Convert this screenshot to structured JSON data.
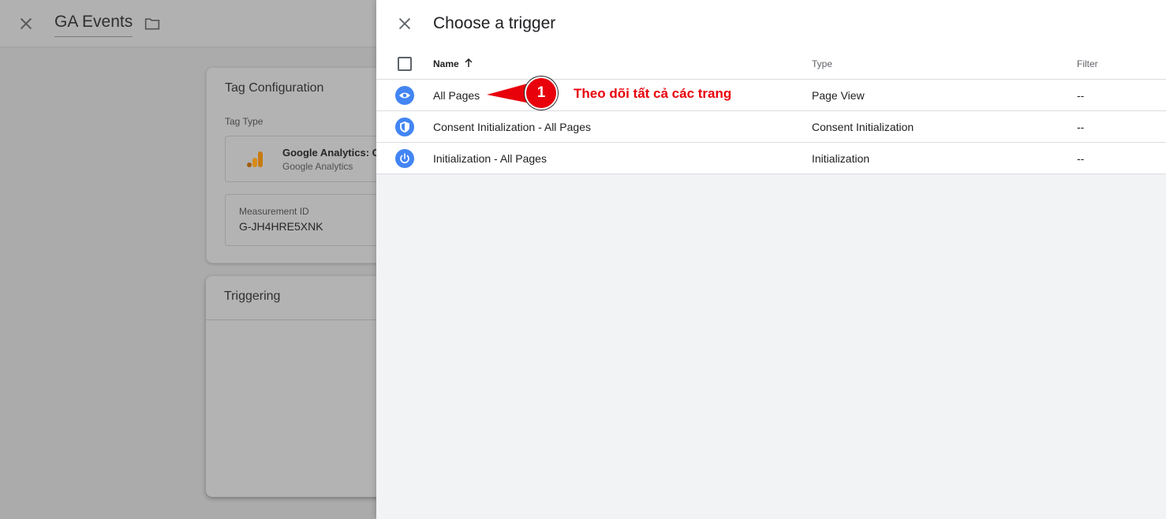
{
  "background_editor": {
    "title": "GA Events",
    "tag_configuration": {
      "title": "Tag Configuration",
      "tag_type_label": "Tag Type",
      "tag_name": "Google Analytics: G",
      "tag_vendor": "Google Analytics",
      "measurement_id_label": "Measurement ID",
      "measurement_id_value": "G-JH4HRE5XNK"
    },
    "triggering": {
      "title": "Triggering"
    }
  },
  "panel": {
    "title": "Choose a trigger",
    "columns": {
      "name": "Name",
      "type": "Type",
      "filter": "Filter"
    },
    "sort": {
      "column": "Name",
      "direction": "ascending"
    },
    "rows": [
      {
        "name": "All Pages",
        "type": "Page View",
        "filter": "--",
        "icon": "eye-icon"
      },
      {
        "name": "Consent Initialization - All Pages",
        "type": "Consent Initialization",
        "filter": "--",
        "icon": "shield-icon"
      },
      {
        "name": "Initialization - All Pages",
        "type": "Initialization",
        "filter": "--",
        "icon": "power-icon"
      }
    ]
  },
  "annotation": {
    "number": "1",
    "text": "Theo dõi tất cả các trang"
  },
  "colors": {
    "accent_blue": "#4285f4",
    "annotation_red": "#e8000b",
    "overlay_gray": "#ababab"
  }
}
